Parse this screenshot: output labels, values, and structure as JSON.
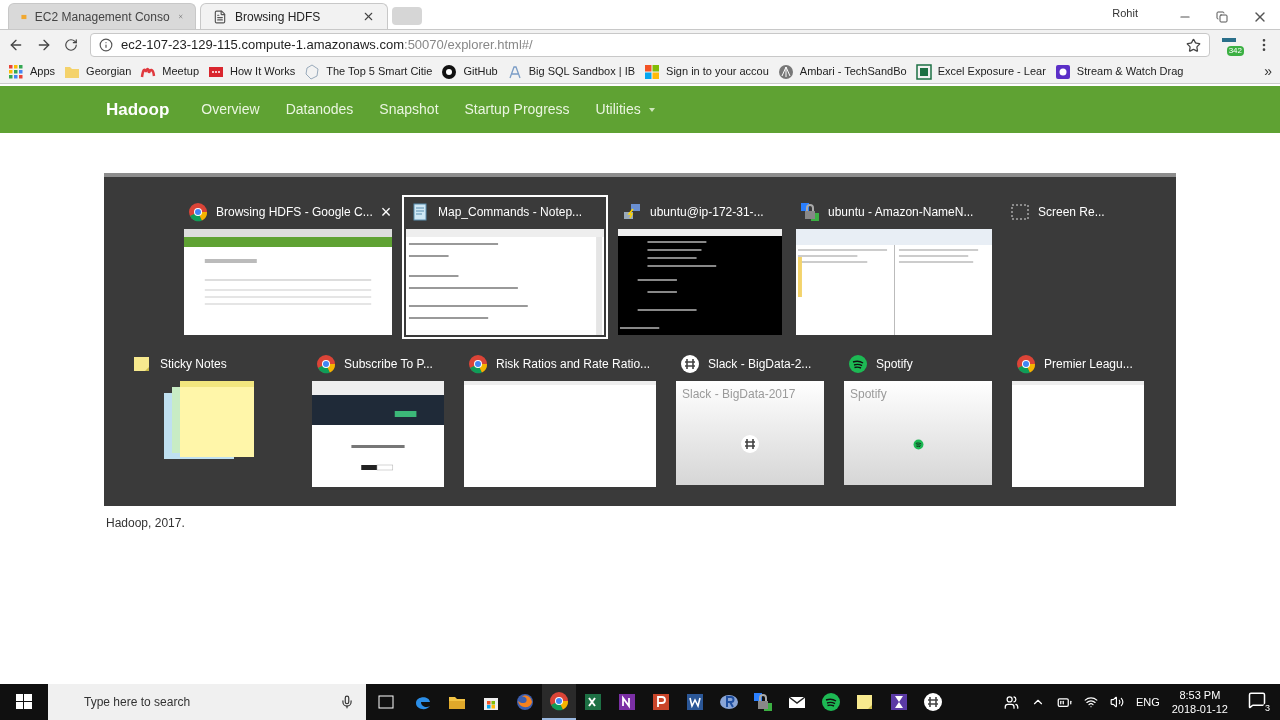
{
  "browser": {
    "tabs": [
      {
        "title": "EC2 Management Conso",
        "kind": "box",
        "selected": false
      },
      {
        "title": "Browsing HDFS",
        "kind": "page",
        "selected": true
      }
    ],
    "user": "Rohit",
    "address": {
      "host": "ec2-107-23-129-115.compute-1.amazonaws.com",
      "rest": ":50070/explorer.html#/"
    },
    "extension_badge": "342",
    "bookmarks": [
      {
        "label": "Apps",
        "kind": "apps"
      },
      {
        "label": "Georgian",
        "kind": "folder"
      },
      {
        "label": "Meetup",
        "kind": "meetup"
      },
      {
        "label": "How It Works",
        "kind": "dots"
      },
      {
        "label": "The Top 5 Smart Citie",
        "kind": "hexagon"
      },
      {
        "label": "GitHub",
        "kind": "github"
      },
      {
        "label": "Big SQL Sandbox | IB",
        "kind": "ibm"
      },
      {
        "label": "Sign in to your accou",
        "kind": "windows"
      },
      {
        "label": "Ambari - TechSandBo",
        "kind": "ambari"
      },
      {
        "label": "Excel Exposure - Lear",
        "kind": "excel"
      },
      {
        "label": "Stream & Watch Drag",
        "kind": "stream"
      }
    ],
    "bookmarks_more": "»"
  },
  "navbar": {
    "brand": "Hadoop",
    "items": [
      {
        "label": "Overview",
        "dropdown": false
      },
      {
        "label": "Datanodes",
        "dropdown": false
      },
      {
        "label": "Snapshot",
        "dropdown": false
      },
      {
        "label": "Startup Progress",
        "dropdown": false
      },
      {
        "label": "Utilities",
        "dropdown": true
      }
    ]
  },
  "task_switcher": {
    "top_windows": [
      {
        "title": "Browsing HDFS - Google C...",
        "kind": "browser",
        "selected": false,
        "close": "×"
      },
      {
        "title": "Map_Commands - Notep...",
        "kind": "notepad",
        "selected": true
      },
      {
        "title": "ubuntu@ip-172-31-...",
        "kind": "terminal",
        "selected": false
      },
      {
        "title": "ubuntu - Amazon-NameN...",
        "kind": "filemanager",
        "selected": false
      },
      {
        "title": "Screen Re...",
        "kind": "snip",
        "selected": false
      }
    ],
    "bottom_windows": [
      {
        "title": "Sticky Notes",
        "kind": "sticky",
        "selected": false
      },
      {
        "title": "Subscribe To P...",
        "kind": "signup",
        "selected": false
      },
      {
        "title": "Risk Ratios and Rate Ratio...",
        "kind": "blank",
        "selected": false
      },
      {
        "title": "Slack - BigData-2...",
        "kind": "slack",
        "preview_text": "Slack - BigData-2017",
        "selected": false
      },
      {
        "title": "Spotify",
        "kind": "spotify",
        "preview_text": "Spotify",
        "selected": false
      },
      {
        "title": "Premier Leagu...",
        "kind": "blank",
        "selected": false
      }
    ]
  },
  "footer": "Hadoop, 2017.",
  "taskbar": {
    "search_placeholder": "Type here to search",
    "apps": [
      {
        "kind": "edge",
        "running": false
      },
      {
        "kind": "explorer",
        "running": false
      },
      {
        "kind": "store",
        "running": false
      },
      {
        "kind": "firefox",
        "running": false
      },
      {
        "kind": "chrome",
        "running": true
      },
      {
        "kind": "excel",
        "running": false
      },
      {
        "kind": "onenote",
        "running": false
      },
      {
        "kind": "powerpoint",
        "running": false
      },
      {
        "kind": "word",
        "running": false
      },
      {
        "kind": "r",
        "running": false
      },
      {
        "kind": "winscp",
        "running": false
      },
      {
        "kind": "mail",
        "running": false
      },
      {
        "kind": "spotify",
        "running": false
      },
      {
        "kind": "sticky",
        "running": false
      },
      {
        "kind": "hourglass",
        "running": false
      },
      {
        "kind": "slack",
        "running": false
      }
    ],
    "language": "ENG",
    "time": "8:53 PM",
    "date": "2018-01-12",
    "notifications": "3"
  }
}
